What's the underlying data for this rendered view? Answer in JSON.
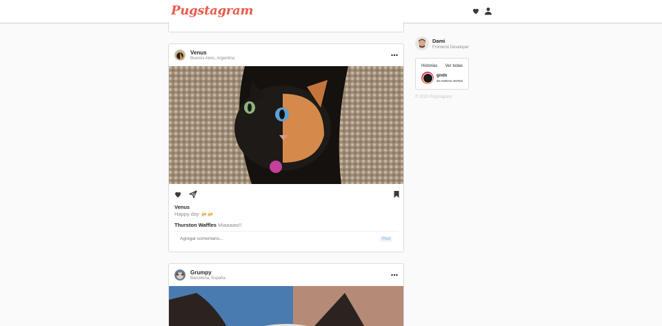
{
  "app": {
    "logo": "Pugstagram"
  },
  "header": {
    "icons": [
      "heart-icon",
      "user-icon"
    ]
  },
  "posts": [
    {
      "user": "Venus",
      "location": "Buenos Aires, Argentina",
      "caption_user": "Venus",
      "caption": "Happy day 🍻🍻",
      "comment_user": "Thurston Waffles",
      "comment_text": "Miaaaaw!!",
      "comment_placeholder": "Agregar comentario...",
      "post_label": "Post"
    },
    {
      "user": "Grumpy",
      "location": "Barcelona, España"
    }
  ],
  "sidebar": {
    "profile_name": "Dami",
    "profile_role": "Frontend Developer",
    "stories_title": "Historias",
    "stories_all": "Ver todas",
    "story_user": "gndx",
    "story_time": "30 HORAS ANTES",
    "copyright": "© 2020 Pugstagram"
  },
  "colors": {
    "brand": "#e65a4a",
    "link": "#7aa7d8"
  }
}
